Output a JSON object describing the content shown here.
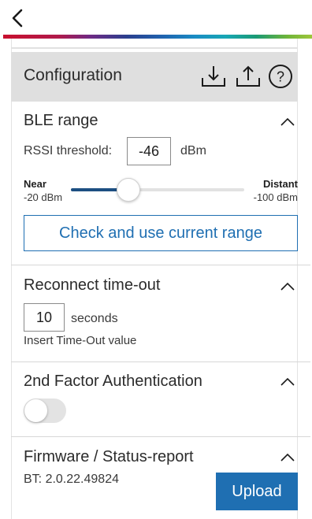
{
  "config": {
    "title": "Configuration"
  },
  "ble": {
    "title": "BLE range",
    "rssi_label": "RSSI threshold:",
    "rssi_value": "-46",
    "rssi_unit": "dBm",
    "near_label": "Near",
    "near_value": "-20 dBm",
    "distant_label": "Distant",
    "distant_value": "-100 dBm",
    "slider_fraction": 0.33,
    "check_button": "Check and use current range"
  },
  "reconnect": {
    "title": "Reconnect time-out",
    "value": "10",
    "unit": "seconds",
    "hint": "Insert Time-Out value"
  },
  "twofa": {
    "title": "2nd Factor Authentication",
    "enabled": false
  },
  "firmware": {
    "title": "Firmware / Status-report",
    "bt_version": "BT: 2.0.22.49824",
    "upload_button": "Upload"
  },
  "colors": {
    "accent": "#1f6fb2",
    "slider_fill": "#1d4f82",
    "header_bg": "#dfdfdf"
  },
  "icons": [
    "back-icon",
    "download-icon",
    "upload-icon",
    "help-icon",
    "chevron-up-icon"
  ]
}
